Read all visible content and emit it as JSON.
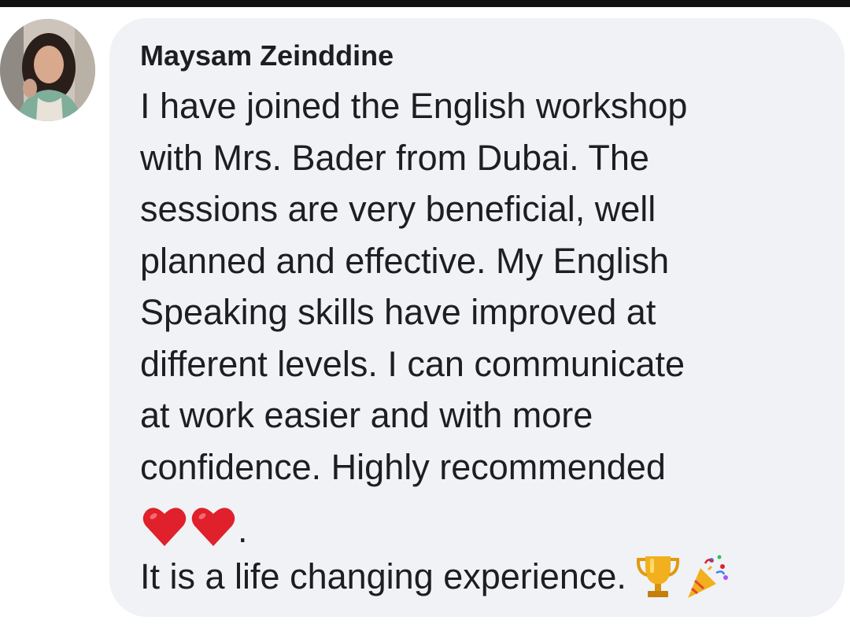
{
  "comment": {
    "author": "Maysam Zeinddine",
    "lines": [
      "I have joined the English workshop",
      "with Mrs. Bader from Dubai. The",
      "sessions are very beneficial, well",
      "planned and effective. My English",
      "Speaking skills have improved at",
      "different levels. I can communicate",
      "at work easier and with more",
      "confidence. Highly recommended"
    ],
    "emoji_line_end": ".",
    "last_line": "It is a life changing experience.",
    "emojis": [
      "heart-icon",
      "heart-icon",
      "trophy-icon",
      "party-popper-icon"
    ]
  },
  "colors": {
    "bubble": "#f0f2f5",
    "text": "#1c1e21",
    "heart": "#e0202a",
    "trophy": "#f2b01e"
  }
}
